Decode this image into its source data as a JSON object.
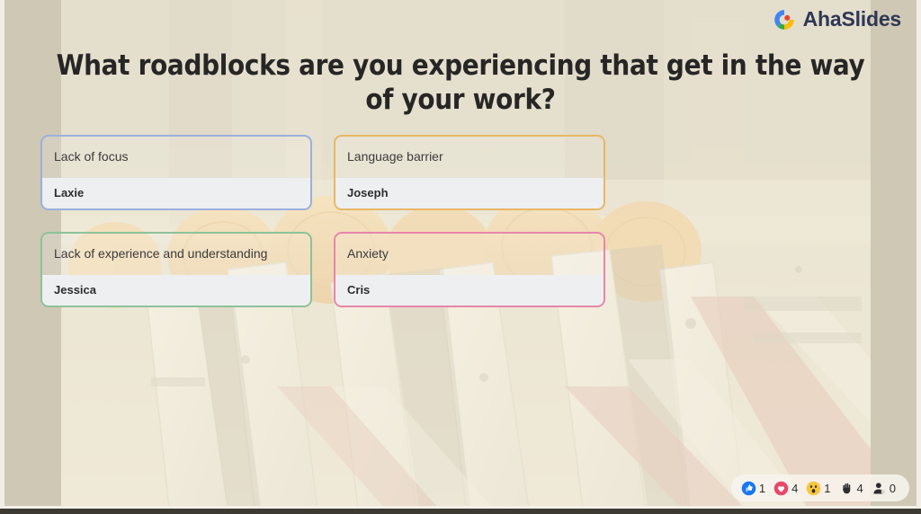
{
  "brand": {
    "name": "AhaSlides",
    "logo_icon": "ahaslides-logo-icon",
    "logo_colors": {
      "blue": "#4285f4",
      "green": "#34a853",
      "yellow": "#fbbc05",
      "red": "#ea4335",
      "wordmark": "#2e3755"
    }
  },
  "slide": {
    "question": "What roadblocks are you experiencing that get in the way of your work?",
    "background_description": "construction-site-photo-faded"
  },
  "answers": [
    {
      "text": "Lack of focus",
      "author": "Laxie",
      "border_color": "#9bb0dd"
    },
    {
      "text": "Language barrier",
      "author": "Joseph",
      "border_color": "#e8b766"
    },
    {
      "text": "Lack of experience and understanding",
      "author": "Jessica",
      "border_color": "#8dc299"
    },
    {
      "text": "Anxiety",
      "author": "Cris",
      "border_color": "#e885ab"
    }
  ],
  "reactions": [
    {
      "icon": "thumbs-up-icon",
      "count": "1",
      "color": "#1878f2"
    },
    {
      "icon": "heart-icon",
      "count": "4",
      "color": "#e8486b"
    },
    {
      "icon": "surprised-face-icon",
      "count": "1",
      "color": "#f7c63e"
    },
    {
      "icon": "raised-hand-icon",
      "count": "4",
      "color": "#2d2d2d"
    },
    {
      "icon": "person-icon",
      "count": "0",
      "color": "#2d2d2d"
    }
  ]
}
